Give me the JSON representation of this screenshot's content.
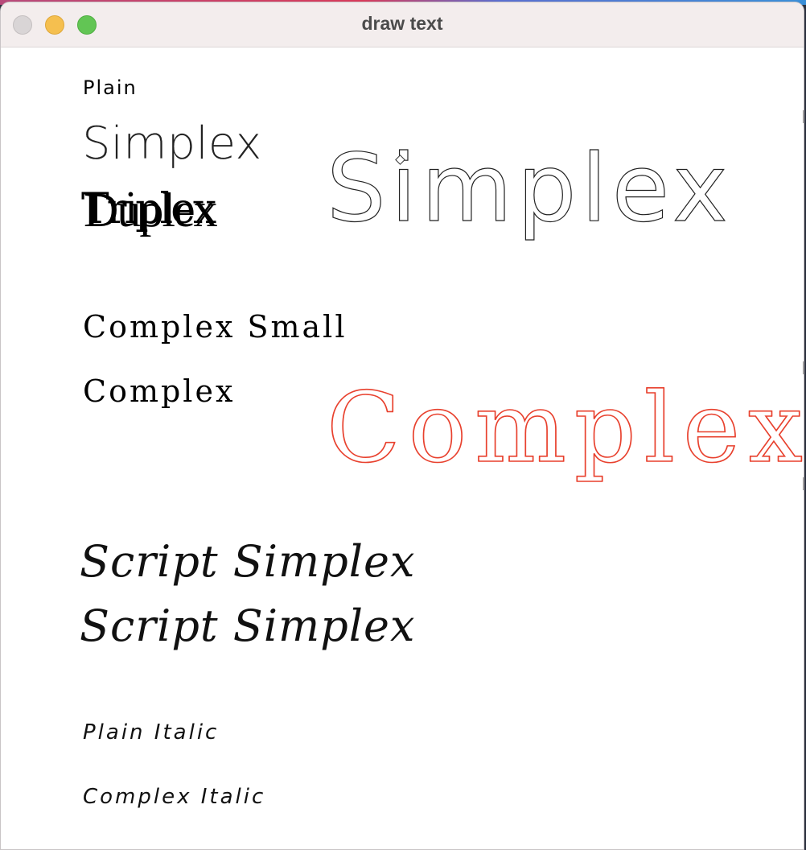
{
  "window": {
    "title": "draw text"
  },
  "canvas": {
    "plain": "Plain",
    "simplex_small": "Simplex",
    "duplex": "Duplex",
    "triplex": "Triplex",
    "simplex_large": "Simplex",
    "complex_small": "Complex Small",
    "complex": "Complex",
    "complex_large": "Complex",
    "script_simplex_1": "Script Simplex",
    "script_simplex_2": "Script Simplex",
    "plain_italic": "Plain Italic",
    "complex_italic": "Complex Italic"
  },
  "colors": {
    "accent_text": "#e8412e",
    "text": "#000000",
    "titlebar": "#f3eded"
  }
}
